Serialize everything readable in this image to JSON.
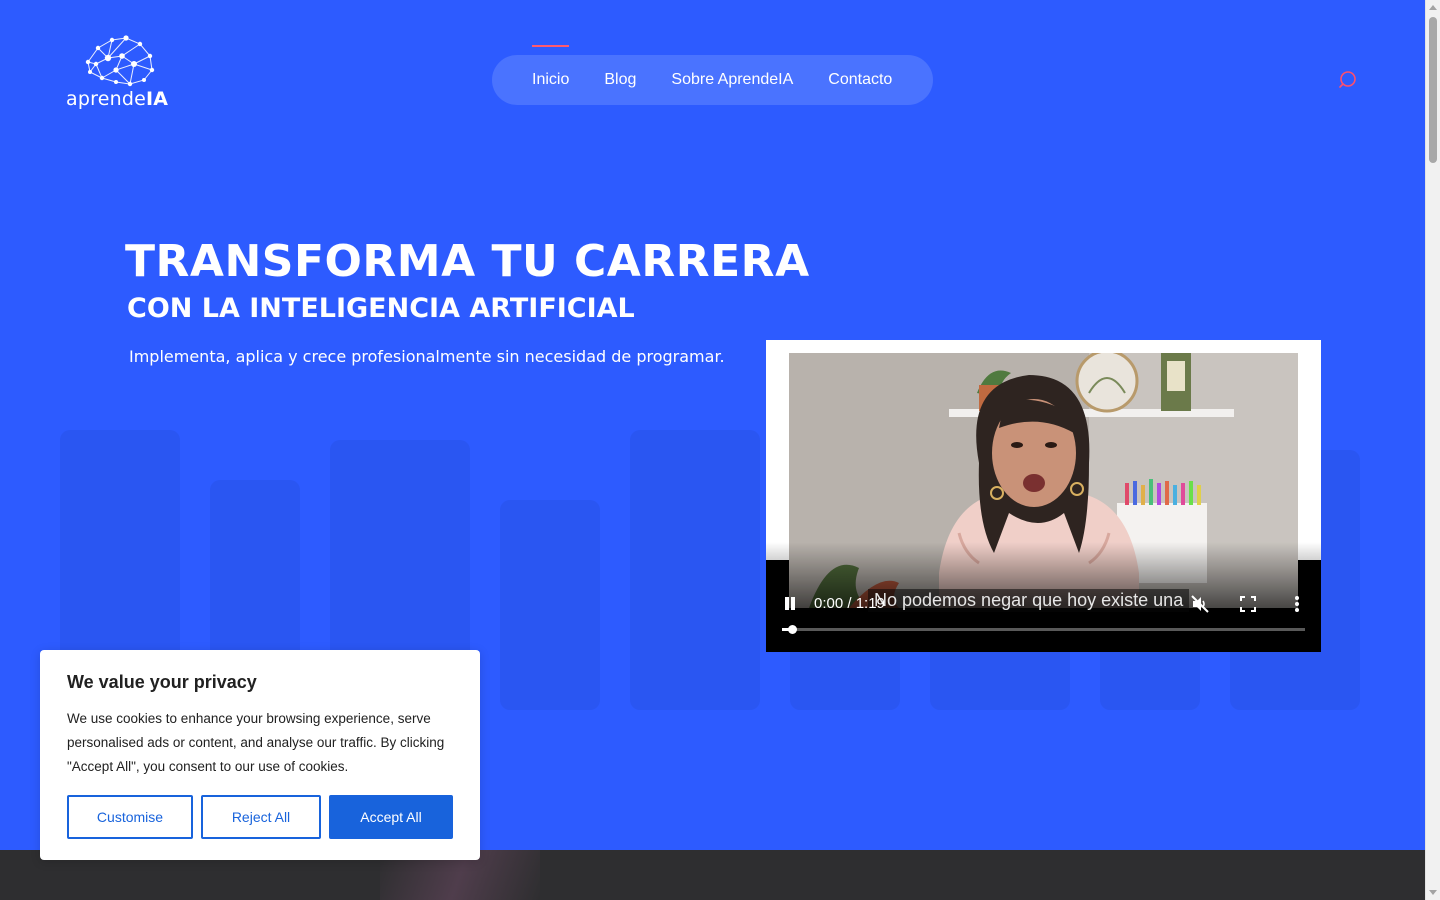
{
  "logo": {
    "text_light": "aprende",
    "text_bold": "IA",
    "icon": "brain-network-icon"
  },
  "nav": {
    "items": [
      {
        "label": "Inicio",
        "active": true
      },
      {
        "label": "Blog",
        "active": false
      },
      {
        "label": "Sobre AprendeIA",
        "active": false
      },
      {
        "label": "Contacto",
        "active": false
      }
    ],
    "search_icon": "search-icon"
  },
  "hero": {
    "title": "TRANSFORMA TU CARRERA",
    "subtitle": "CON LA INTELIGENCIA ARTIFICIAL",
    "description": "Implementa, aplica y crece profesionalmente sin necesidad de programar."
  },
  "video": {
    "time": "0:00 / 1:19",
    "caption": "No podemos negar que hoy existe una",
    "progress": 0.02,
    "muted": true,
    "controls": {
      "pause_icon": "pause-icon",
      "mute_icon": "muted-speaker-icon",
      "fullscreen_icon": "fullscreen-icon",
      "more_icon": "more-vertical-icon"
    }
  },
  "cookie": {
    "title": "We value your privacy",
    "text": "We use cookies to enhance your browsing experience, serve personalised ads or content, and analyse our traffic. By clicking \"Accept All\", you consent to our use of cookies.",
    "customise_label": "Customise",
    "reject_label": "Reject All",
    "accept_label": "Accept All"
  },
  "colors": {
    "hero_bg": "#2d5bff",
    "nav_bg": "#4a73ff",
    "accent_red": "#ff5a6e",
    "cookie_blue": "#1863dc",
    "footer_dark": "#2e2e30"
  }
}
